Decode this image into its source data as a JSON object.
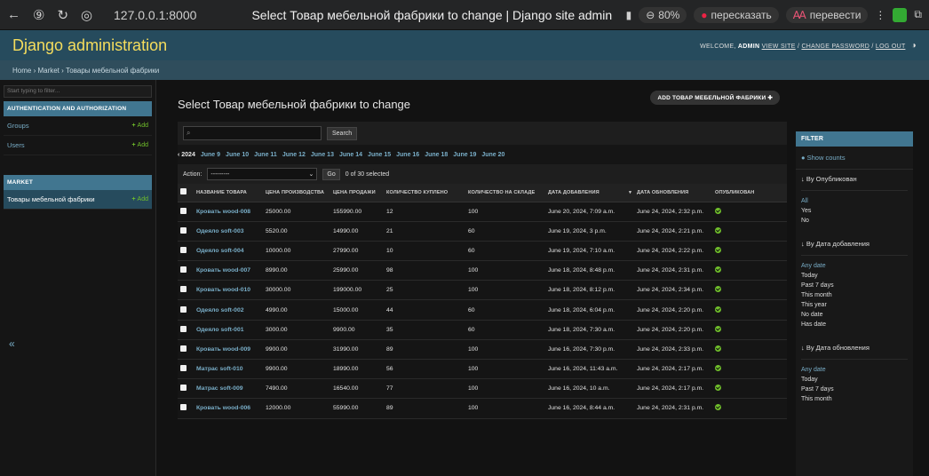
{
  "browser": {
    "url": "127.0.0.1:8000",
    "tab_title": "Select Товар мебельной фабрики to change | Django site admin",
    "zoom": "80%",
    "retell": "пересказать",
    "translate": "перевести"
  },
  "header": {
    "brand": "Django administration",
    "welcome": "WELCOME,",
    "user": "ADMIN",
    "view_site": "VIEW SITE",
    "sep": " / ",
    "change_password": "CHANGE PASSWORD",
    "logout": "LOG OUT"
  },
  "breadcrumbs": "Home › Market › Товары мебельной фабрики",
  "sidebar": {
    "filter_placeholder": "Start typing to filter...",
    "modules": [
      {
        "caption": "AUTHENTICATION AND AUTHORIZATION",
        "items": [
          {
            "label": "Groups",
            "add": "Add"
          },
          {
            "label": "Users",
            "add": "Add"
          }
        ]
      },
      {
        "caption": "MARKET",
        "items": [
          {
            "label": "Товары мебельной фабрики",
            "add": "Add"
          }
        ]
      }
    ],
    "collapse": "«"
  },
  "page": {
    "title": "Select Товар мебельной фабрики to change",
    "add_button": "ADD ТОВАР МЕБЕЛЬНОЙ ФАБРИКИ"
  },
  "search": {
    "button": "Search"
  },
  "date_hierarchy": {
    "back": "‹ 2024",
    "days": [
      "June 9",
      "June 10",
      "June 11",
      "June 12",
      "June 13",
      "June 14",
      "June 15",
      "June 16",
      "June 18",
      "June 19",
      "June 20"
    ]
  },
  "actions": {
    "label": "Action:",
    "selected": "---------",
    "go": "Go",
    "counter": "0 of 30 selected"
  },
  "table": {
    "headers": [
      "НАЗВАНИЕ ТОВАРА",
      "ЦЕНА ПРОИЗВОДСТВА",
      "ЦЕНА ПРОДАЖИ",
      "КОЛИЧЕСТВО КУПЛЕНО",
      "КОЛИЧЕСТВО НА СКЛАДЕ",
      "ДАТА ДОБАВЛЕНИЯ",
      "ДАТА ОБНОВЛЕНИЯ",
      "ОПУБЛИКОВАН"
    ],
    "rows": [
      [
        "Кровать wood-008",
        "25000.00",
        "155990.00",
        "12",
        "100",
        "June 20, 2024, 7:09 a.m.",
        "June 24, 2024, 2:32 p.m."
      ],
      [
        "Одеяло soft-003",
        "5520.00",
        "14990.00",
        "21",
        "60",
        "June 19, 2024, 3 p.m.",
        "June 24, 2024, 2:21 p.m."
      ],
      [
        "Одеяло soft-004",
        "10000.00",
        "27990.00",
        "10",
        "60",
        "June 19, 2024, 7:10 a.m.",
        "June 24, 2024, 2:22 p.m."
      ],
      [
        "Кровать wood-007",
        "8990.00",
        "25990.00",
        "98",
        "100",
        "June 18, 2024, 8:48 p.m.",
        "June 24, 2024, 2:31 p.m."
      ],
      [
        "Кровать wood-010",
        "30000.00",
        "199000.00",
        "25",
        "100",
        "June 18, 2024, 8:12 p.m.",
        "June 24, 2024, 2:34 p.m."
      ],
      [
        "Одеяло soft-002",
        "4990.00",
        "15000.00",
        "44",
        "60",
        "June 18, 2024, 6:04 p.m.",
        "June 24, 2024, 2:20 p.m."
      ],
      [
        "Одеяло soft-001",
        "3000.00",
        "9900.00",
        "35",
        "60",
        "June 18, 2024, 7:30 a.m.",
        "June 24, 2024, 2:20 p.m."
      ],
      [
        "Кровать wood-009",
        "9900.00",
        "31990.00",
        "89",
        "100",
        "June 16, 2024, 7:30 p.m.",
        "June 24, 2024, 2:33 p.m."
      ],
      [
        "Матрас soft-010",
        "9900.00",
        "18990.00",
        "56",
        "100",
        "June 16, 2024, 11:43 a.m.",
        "June 24, 2024, 2:17 p.m."
      ],
      [
        "Матрас soft-009",
        "7490.00",
        "16540.00",
        "77",
        "100",
        "June 16, 2024, 10 a.m.",
        "June 24, 2024, 2:17 p.m."
      ],
      [
        "Кровать wood-006",
        "12000.00",
        "55990.00",
        "89",
        "100",
        "June 16, 2024, 8:44 a.m.",
        "June 24, 2024, 2:31 p.m."
      ]
    ]
  },
  "filter": {
    "title": "FILTER",
    "show_counts": "Show counts",
    "sections": [
      {
        "title": "↓ By Опубликован",
        "items": [
          "All",
          "Yes",
          "No"
        ]
      },
      {
        "title": "↓ By Дата добавления",
        "items": [
          "Any date",
          "Today",
          "Past 7 days",
          "This month",
          "This year",
          "No date",
          "Has date"
        ]
      },
      {
        "title": "↓ By Дата обновления",
        "items": [
          "Any date",
          "Today",
          "Past 7 days",
          "This month"
        ]
      }
    ]
  },
  "colors": {
    "header": "#264b5d",
    "brand": "#f5dd5d",
    "link": "#79aec8",
    "add": "#70bf2b",
    "caption": "#417690"
  }
}
